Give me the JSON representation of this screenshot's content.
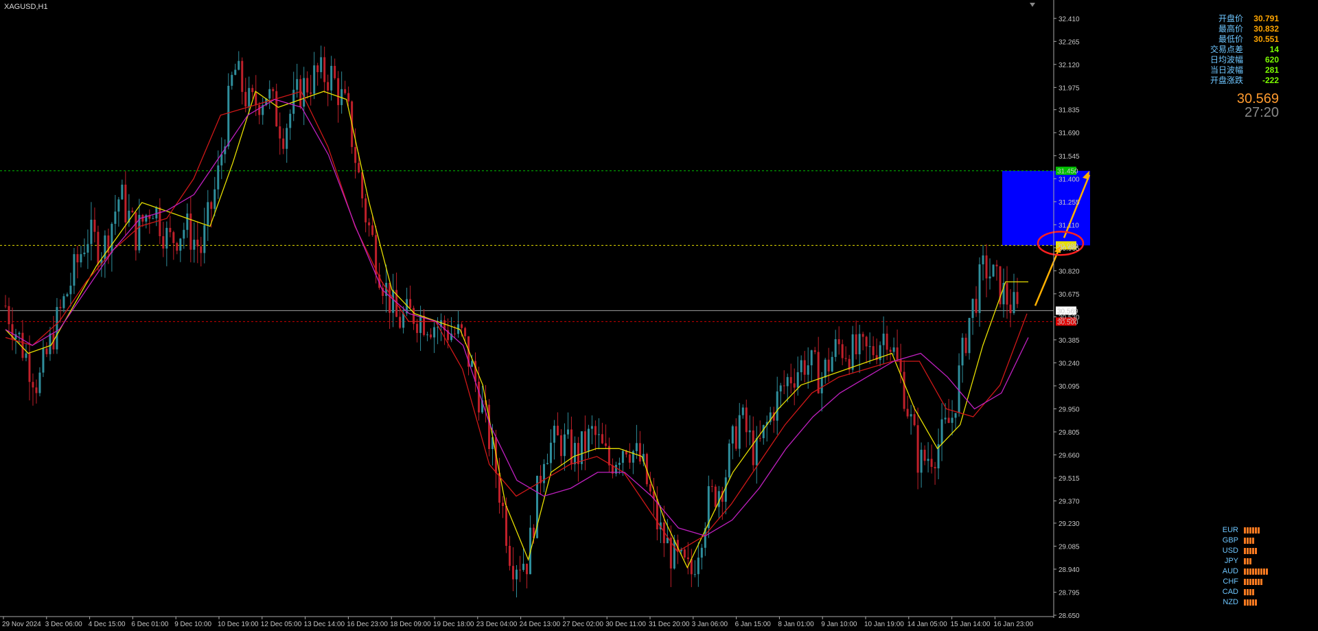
{
  "symbol": "XAGUSD,H1",
  "info_panel": [
    {
      "label": "开盘价",
      "value": "30.791",
      "color": "orange"
    },
    {
      "label": "最高价",
      "value": "30.832",
      "color": "orange"
    },
    {
      "label": "最低价",
      "value": "30.551",
      "color": "orange"
    },
    {
      "label": "交易点差",
      "value": "14",
      "color": "green"
    },
    {
      "label": "日均波幅",
      "value": "620",
      "color": "green"
    },
    {
      "label": "当日波幅",
      "value": "281",
      "color": "green"
    },
    {
      "label": "开盘涨跌",
      "value": "-222",
      "color": "green"
    }
  ],
  "big_price": "30.569",
  "big_timer": "27:20",
  "currency_strength": [
    {
      "name": "EUR",
      "bars": 6
    },
    {
      "name": "GBP",
      "bars": 4
    },
    {
      "name": "USD",
      "bars": 5
    },
    {
      "name": "JPY",
      "bars": 3
    },
    {
      "name": "AUD",
      "bars": 9
    },
    {
      "name": "CHF",
      "bars": 7
    },
    {
      "name": "CAD",
      "bars": 4
    },
    {
      "name": "NZD",
      "bars": 5
    }
  ],
  "chart_data": {
    "type": "candlestick",
    "title": "XAGUSD,H1",
    "ylim": [
      28.65,
      32.5
    ],
    "y_ticks": [
      "32.410",
      "32.265",
      "32.120",
      "31.975",
      "31.835",
      "31.690",
      "31.545",
      "31.400",
      "31.255",
      "31.110",
      "30.965",
      "30.820",
      "30.675",
      "30.530",
      "30.385",
      "30.240",
      "30.095",
      "29.950",
      "29.805",
      "29.660",
      "29.515",
      "29.370",
      "29.230",
      "29.085",
      "28.940",
      "28.795",
      "28.650"
    ],
    "x_ticks": [
      "29 Nov 2024",
      "3 Dec 06:00",
      "4 Dec 15:00",
      "6 Dec 01:00",
      "9 Dec 10:00",
      "10 Dec 19:00",
      "12 Dec 05:00",
      "13 Dec 14:00",
      "16 Dec 23:00",
      "18 Dec 09:00",
      "19 Dec 18:00",
      "23 Dec 04:00",
      "24 Dec 13:00",
      "27 Dec 02:00",
      "30 Dec 11:00",
      "31 Dec 20:00",
      "3 Jan 06:00",
      "6 Jan 15:00",
      "8 Jan 01:00",
      "9 Jan 10:00",
      "10 Jan 19:00",
      "14 Jan 05:00",
      "15 Jan 14:00",
      "16 Jan 23:00"
    ],
    "close_path": [
      30.6,
      30.35,
      30.1,
      30.45,
      30.75,
      31.05,
      30.95,
      31.3,
      31.05,
      31.25,
      31.0,
      31.1,
      30.95,
      31.4,
      32.1,
      31.85,
      31.95,
      31.7,
      31.95,
      32.05,
      32.05,
      31.8,
      31.2,
      30.8,
      30.5,
      30.55,
      30.5,
      30.45,
      30.4,
      30.05,
      29.6,
      29.0,
      29.0,
      29.7,
      29.75,
      29.65,
      29.8,
      29.6,
      29.75,
      29.6,
      29.2,
      29.0,
      28.9,
      29.35,
      29.5,
      29.9,
      29.65,
      29.95,
      30.15,
      30.25,
      30.15,
      30.35,
      30.3,
      30.3,
      30.45,
      30.1,
      29.6,
      29.7,
      29.9,
      30.5,
      30.85,
      30.7,
      30.55
    ],
    "ma_fast": [
      30.45,
      30.3,
      30.35,
      30.6,
      30.85,
      31.05,
      31.25,
      31.2,
      31.15,
      31.1,
      31.5,
      31.95,
      31.85,
      31.9,
      31.95,
      31.9,
      31.25,
      30.7,
      30.55,
      30.5,
      30.45,
      30.1,
      29.35,
      29.0,
      29.55,
      29.65,
      29.7,
      29.7,
      29.65,
      29.25,
      28.95,
      29.25,
      29.55,
      29.75,
      29.95,
      30.1,
      30.15,
      30.2,
      30.25,
      30.3,
      29.95,
      29.7,
      29.85,
      30.35,
      30.75,
      30.75
    ],
    "ma_mid": [
      30.4,
      30.35,
      30.5,
      30.75,
      30.95,
      31.1,
      31.15,
      31.4,
      31.8,
      31.85,
      31.9,
      31.95,
      31.6,
      31.1,
      30.75,
      30.5,
      30.5,
      30.2,
      29.6,
      29.4,
      29.5,
      29.6,
      29.65,
      29.55,
      29.3,
      29.05,
      29.15,
      29.35,
      29.6,
      29.85,
      30.05,
      30.15,
      30.2,
      30.25,
      30.25,
      29.95,
      29.9,
      30.1,
      30.55
    ],
    "ma_slow": [
      30.45,
      30.35,
      30.45,
      30.7,
      30.95,
      31.15,
      31.2,
      31.3,
      31.55,
      31.8,
      31.9,
      31.85,
      31.55,
      31.1,
      30.7,
      30.55,
      30.5,
      30.35,
      29.85,
      29.5,
      29.4,
      29.45,
      29.55,
      29.55,
      29.4,
      29.2,
      29.15,
      29.25,
      29.45,
      29.7,
      29.9,
      30.05,
      30.15,
      30.25,
      30.3,
      30.15,
      29.95,
      30.05,
      30.4
    ],
    "levels": [
      {
        "value": 31.45,
        "label": "31.450",
        "color": "#00c000",
        "tag_bg": "#00c000"
      },
      {
        "value": 30.98,
        "label": "30.980",
        "color": "#e8e000",
        "tag_bg": "#e8e000"
      },
      {
        "value": 30.569,
        "label": "30.569",
        "color": "#a0a0a0",
        "tag_bg": "#ffffff"
      },
      {
        "value": 30.5,
        "label": "30.500",
        "color": "#d00000",
        "tag_bg": "#e00000"
      }
    ],
    "target_zone": {
      "low": 30.98,
      "high": 31.45
    },
    "arrow": {
      "from": 30.6,
      "via": 30.98,
      "to": 31.45
    }
  }
}
